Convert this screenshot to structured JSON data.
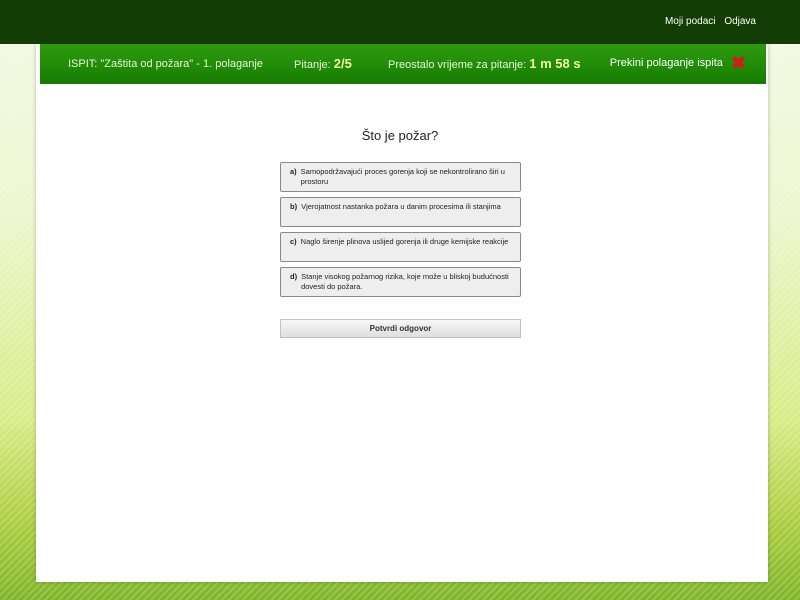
{
  "nav": {
    "my_data": "Moji podaci",
    "logout": "Odjava"
  },
  "exam": {
    "title": "ISPIT: \"Zaštita od požara\" - 1. polaganje",
    "question_label": "Pitanje:",
    "question_value": "2/5",
    "timer_label": "Preostalo vrijeme za pitanje:",
    "timer_value": "1 m 58 s",
    "abort_label": "Prekini polaganje ispita"
  },
  "question": {
    "text": "Što je požar?",
    "answers": [
      {
        "letter": "a)",
        "text": "Samopodržavajući proces gorenja koji se nekontrolirano širi u prostoru"
      },
      {
        "letter": "b)",
        "text": "Vjerojatnost nastanka požara u danim procesima ili stanjima"
      },
      {
        "letter": "c)",
        "text": "Naglo širenje plinova uslijed gorenja ili druge kemijske reakcije"
      },
      {
        "letter": "d)",
        "text": "Stanje visokog požarnog rizika, koje može u bliskoj budućnosti dovesti do požara."
      }
    ]
  },
  "confirm_label": "Potvrdi odgovor",
  "icons": {
    "abort": "close-icon"
  },
  "colors": {
    "top_bar": "#123d05",
    "exam_bar": "#1f8a06",
    "highlight": "#f2f6a8",
    "abort_icon": "#d91818"
  }
}
